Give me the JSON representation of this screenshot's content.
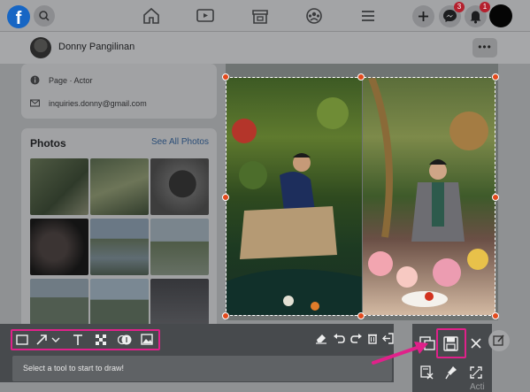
{
  "nav": {
    "logo_letter": "f",
    "messenger_badge": "3",
    "notifications_badge": "1"
  },
  "profile": {
    "name": "Donny Pangilinan",
    "more_label": "•••"
  },
  "intro": {
    "page_type": "Page · Actor",
    "email": "inquiries.donny@gmail.com"
  },
  "photos": {
    "title": "Photos",
    "see_all": "See All Photos"
  },
  "drawing_toolbar": {
    "message": "Select a tool to start to draw!",
    "tools": [
      "rectangle-icon",
      "arrow-icon",
      "text-icon",
      "mosaic-icon",
      "numbered-marker-icon",
      "image-icon"
    ],
    "actions": [
      "eraser-icon",
      "undo-icon",
      "redo-icon",
      "trash-icon",
      "exit-icon"
    ]
  },
  "action_panel": {
    "icons": [
      "copy-icon",
      "save-icon",
      "close-icon",
      "translate-icon",
      "pin-icon",
      "fullscreen-icon"
    ]
  },
  "colors": {
    "highlight": "#e0218a",
    "handle": "#e24a1d",
    "toolbar_bg": "#474a4d"
  },
  "watermark": "Acti"
}
